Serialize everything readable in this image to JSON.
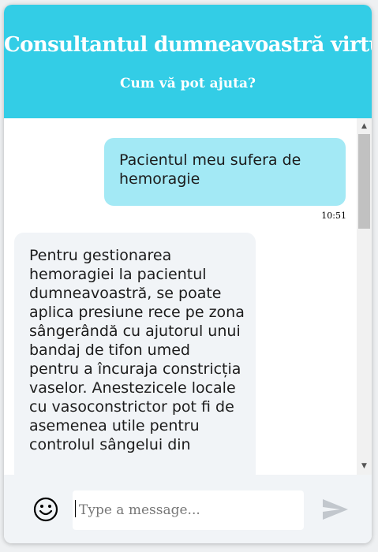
{
  "header": {
    "title": "Consultantul dumneavoastră virtual",
    "subtitle": "Cum vă pot ajuta?"
  },
  "messages": {
    "user_text": "Pacientul meu sufera de hemoragie",
    "user_time": "10:51",
    "bot_text": "Pentru gestionarea hemoragiei la pacientul dumneavoastră, se poate aplica presiune rece pe zona sângerândă cu ajutorul unui bandaj de tifon umed pentru a încuraja constricția vaselor. Anestezicele locale cu vasoconstrictor pot fi de asemenea utile pentru controlul sângelui din"
  },
  "input": {
    "placeholder": "Type a message..."
  },
  "icons": {
    "emoji": "smiley-face-icon",
    "send": "paper-plane-send-icon",
    "scroll_up": "scroll-up-arrow-icon",
    "scroll_down": "scroll-down-arrow-icon"
  },
  "colors": {
    "header_bg": "#33cde6",
    "user_bubble": "#a3e9f5",
    "bot_bubble": "#f1f4f7",
    "input_bar": "#f1f4f7",
    "send_icon": "#c2c7cd"
  }
}
